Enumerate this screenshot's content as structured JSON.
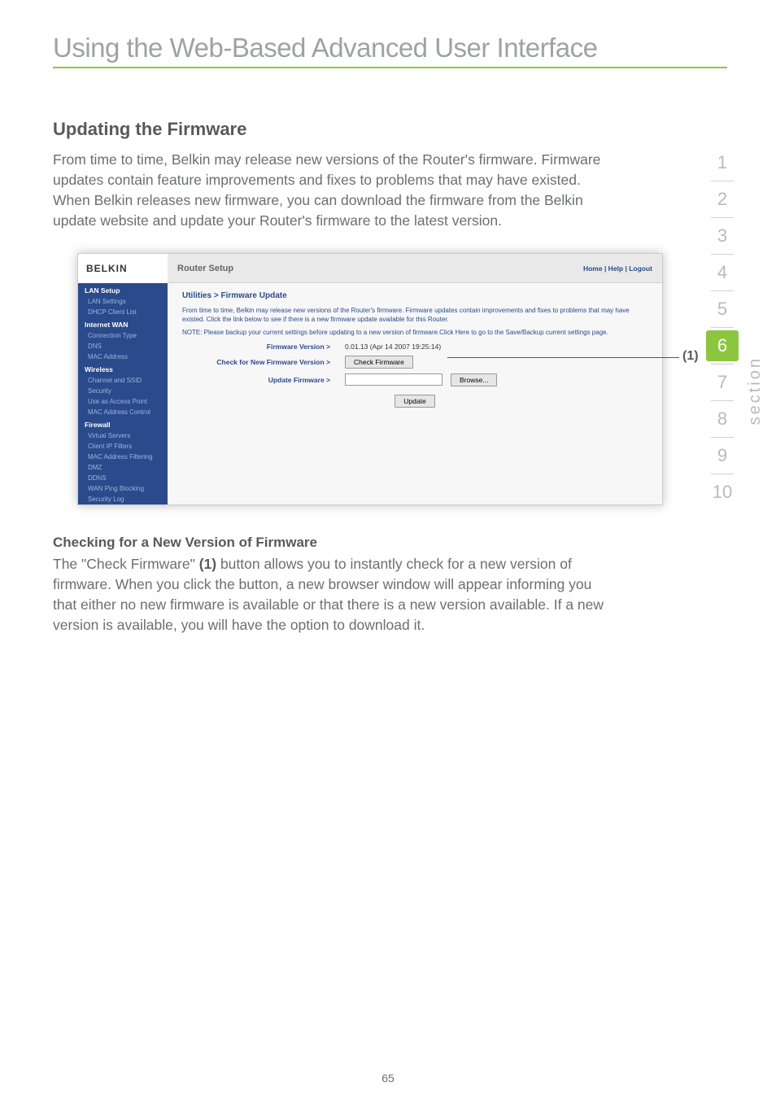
{
  "page": {
    "title": "Using the Web-Based Advanced User Interface",
    "number": "65",
    "section_label": "section"
  },
  "sideNav": {
    "items": [
      "1",
      "2",
      "3",
      "4",
      "5",
      "6",
      "7",
      "8",
      "9",
      "10"
    ],
    "activeIndex": 5
  },
  "main": {
    "heading": "Updating the Firmware",
    "intro": "From time to time, Belkin may release new versions of the Router's firmware. Firmware updates contain feature improvements and fixes to problems that may have existed. When Belkin releases new firmware, you can download the firmware from the Belkin update website and update your Router's firmware to the latest version.",
    "subheading": "Checking for a New Version of Firmware",
    "sub_para_prefix": "The \"Check Firmware\" ",
    "sub_para_bold": "(1)",
    "sub_para_suffix": " button allows you to instantly check for a new version of firmware. When you click the button, a new browser window will appear informing you that either no new firmware is available or that there is a new version available. If a new version is available, you will have the option to download it."
  },
  "callout": {
    "label": "(1)"
  },
  "routerUI": {
    "brand": "BELKIN",
    "headerTitle": "Router Setup",
    "headerLinks": "Home | Help | Logout",
    "breadcrumb": "Utilities > Firmware Update",
    "para1": "From time to time, Belkin may release new versions of the Router's firmware. Firmware updates contain improvements and fixes to problems that may have existed. Click the link below to see if there is a new firmware update available for this Router.",
    "para2_a": "NOTE: Please backup your current settings before updating to a new version of firmware.Click Here to go to the Save/Backup current settings page.",
    "rows": {
      "fwVersionLabel": "Firmware Version >",
      "fwVersionValue": "0.01.13 (Apr 14 2007 19:25:14)",
      "checkLabel": "Check for New Firmware Version >",
      "checkBtn": "Check Firmware",
      "updateLabel": "Update Firmware >",
      "browseBtn": "Browse...",
      "updateBtn": "Update"
    },
    "sidebar": {
      "groups": [
        {
          "head": "LAN Setup",
          "items": [
            "LAN Settings",
            "DHCP Client List"
          ]
        },
        {
          "head": "Internet WAN",
          "items": [
            "Connection Type",
            "DNS",
            "MAC Address"
          ]
        },
        {
          "head": "Wireless",
          "items": [
            "Channel and SSID",
            "Security",
            "Use as Access Point",
            "MAC Address Control"
          ]
        },
        {
          "head": "Firewall",
          "items": [
            "Virtual Servers",
            "Client IP Filters",
            "MAC Address Filtering",
            "DMZ",
            "DDNS",
            "WAN Ping Blocking",
            "Security Log"
          ]
        }
      ]
    }
  }
}
